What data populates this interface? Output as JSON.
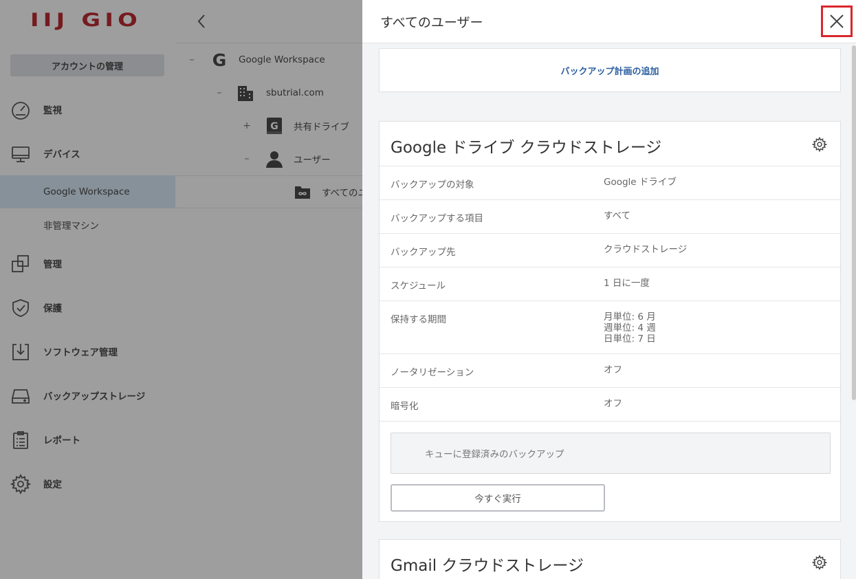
{
  "sidebar": {
    "logo": "IIJ GIO",
    "account_button": "アカウントの管理",
    "items": [
      {
        "label": "監視",
        "icon": "gauge-icon"
      },
      {
        "label": "デバイス",
        "icon": "monitor-icon"
      },
      {
        "label": "管理",
        "icon": "copy-icon"
      },
      {
        "label": "保護",
        "icon": "shield-icon"
      },
      {
        "label": "ソフトウェア管理",
        "icon": "download-tray-icon"
      },
      {
        "label": "バックアップストレージ",
        "icon": "drive-icon"
      },
      {
        "label": "レポート",
        "icon": "clipboard-icon"
      },
      {
        "label": "設定",
        "icon": "gear-icon"
      }
    ],
    "sub_items": [
      {
        "label": "Google Workspace"
      },
      {
        "label": "非管理マシン"
      }
    ]
  },
  "tree": {
    "nodes": [
      {
        "toggle": "–",
        "label": "Google Workspace",
        "icon": "google-g-icon"
      },
      {
        "toggle": "–",
        "label": "sbutrial.com",
        "icon": "building-icon"
      },
      {
        "toggle": "+",
        "label": "共有ドライブ",
        "icon": "shared-drive-icon"
      },
      {
        "toggle": "–",
        "label": "ユーザー",
        "icon": "user-icon"
      },
      {
        "toggle": "",
        "label": "すべてのユーザー",
        "icon": "infinity-folder-icon"
      }
    ]
  },
  "panel": {
    "title": "すべてのユーザー",
    "add_plan": "バックアップ計画の追加",
    "card1": {
      "title": "Google ドライブ クラウドストレージ",
      "rows": [
        {
          "key": "バックアップの対象",
          "value": [
            "Google ドライブ"
          ]
        },
        {
          "key": "バックアップする項目",
          "value": [
            "すべて"
          ]
        },
        {
          "key": "バックアップ先",
          "value": [
            "クラウドストレージ"
          ]
        },
        {
          "key": "スケジュール",
          "value": [
            "1 日に一度"
          ]
        },
        {
          "key": "保持する期間",
          "value": [
            "月単位: 6 月",
            "週単位: 4 週",
            "日単位: 7 日"
          ]
        },
        {
          "key": "ノータリゼーション",
          "value": [
            "オフ"
          ]
        },
        {
          "key": "暗号化",
          "value": [
            "オフ"
          ]
        }
      ],
      "queue": "キューに登録済みのバックアップ",
      "run_now": "今すぐ実行"
    },
    "card2": {
      "title": "Gmail クラウドストレージ"
    }
  },
  "colors": {
    "brand": "#b5121b",
    "link": "#2c5fa0",
    "close_highlight": "#d9262c",
    "active_nav": "#d4e8f6"
  }
}
